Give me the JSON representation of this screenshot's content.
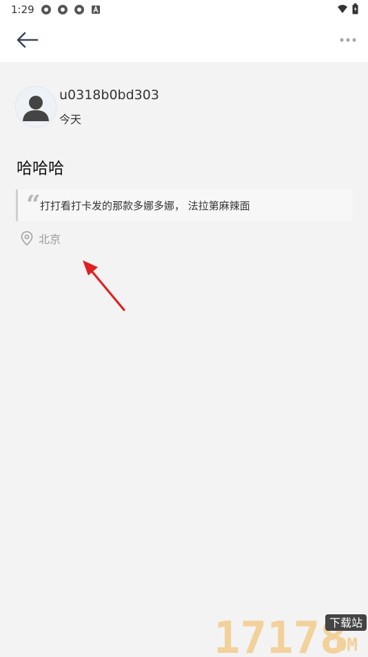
{
  "status_bar": {
    "time": "1:29"
  },
  "post": {
    "username": "u0318b0bd303",
    "date": "今天",
    "title": "哈哈哈",
    "quote": "打打看打卡发的那款多娜多娜， 法拉第麻辣面",
    "location": "北京"
  },
  "watermark": {
    "number": "17178",
    "label": "下载站",
    "domain": "COM"
  },
  "colors": {
    "background": "#f3f3f3",
    "header": "#ffffff",
    "quote_border": "#cfcfcf",
    "arrow": "#e02020",
    "watermark": "#f2d19a"
  }
}
